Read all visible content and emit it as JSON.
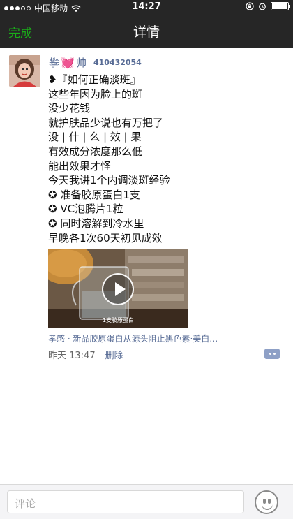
{
  "status_bar": {
    "carrier": "中国移动",
    "time": "14:27"
  },
  "nav": {
    "done_label": "完成",
    "title": "详情"
  },
  "post": {
    "author_name_part1": "攀",
    "author_name_heart": "💓",
    "author_name_part2": "帅",
    "author_number": "410432054",
    "body_lines": [
      "❥『如何正确淡斑』",
      "这些年因为脸上的斑",
      "没少花钱",
      "就护肤品少说也有万把了",
      "没 | 什 | 么 | 效 | 果",
      "有效成分浓度那么低",
      "能出效果才怪",
      "今天我讲1个内调淡斑经验",
      "✪ 准备胶原蛋白1支",
      "✪ VC泡腾片1粒",
      "✪ 同时溶解到冷水里",
      "早晚各1次60天初见成效"
    ],
    "video_caption": "1支胶原蛋白",
    "source_text": "孝感 · 新品胶原蛋白从源头阻止黑色素·美白…",
    "time": "昨天 13:47",
    "delete_label": "删除"
  },
  "comment_bar": {
    "placeholder": "评论"
  },
  "colors": {
    "nav_bg": "#262626",
    "accent_green": "#1aad19",
    "link_blue": "#576b95"
  }
}
